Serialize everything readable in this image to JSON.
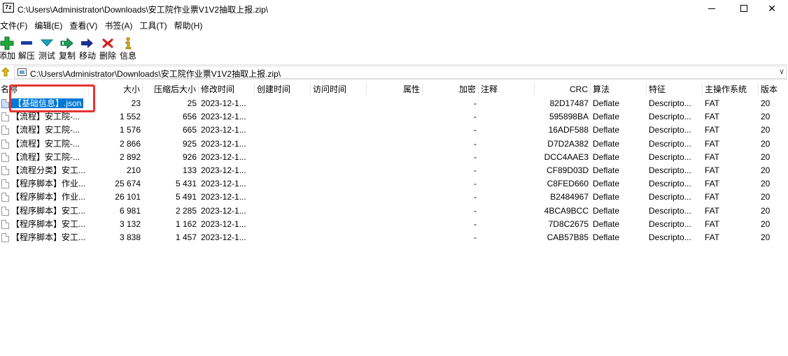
{
  "window": {
    "app_icon": "7z",
    "title": "C:\\Users\\Administrator\\Downloads\\安工院作业票V1V2抽取上报.zip\\",
    "close_glyph": "✕"
  },
  "menu": [
    "文件(F)",
    "编辑(E)",
    "查看(V)",
    "书签(A)",
    "工具(T)",
    "帮助(H)"
  ],
  "toolbar": [
    {
      "label": "添加",
      "icon": "add-icon",
      "color": "#1faa3a"
    },
    {
      "label": "解压",
      "icon": "extract-icon",
      "color": "#1c3f9c"
    },
    {
      "label": "测试",
      "icon": "test-icon",
      "color": "#1fa4c0"
    },
    {
      "label": "复制",
      "icon": "copy-icon",
      "color": "#1e9a5a"
    },
    {
      "label": "移动",
      "icon": "move-icon",
      "color": "#1c2f8c"
    },
    {
      "label": "删除",
      "icon": "delete-icon",
      "color": "#d42020"
    },
    {
      "label": "信息",
      "icon": "info-icon",
      "color": "#d8b400"
    }
  ],
  "address": {
    "path": "C:\\Users\\Administrator\\Downloads\\安工院作业票V1V2抽取上报.zip\\",
    "dropdown_glyph": "∨"
  },
  "columns": [
    "名称",
    "大小",
    "压缩后大小",
    "修改时间",
    "创建时间",
    "访问时间",
    "属性",
    "加密",
    "注释",
    "CRC",
    "算法",
    "特征",
    "主操作系统",
    "版本"
  ],
  "files": [
    {
      "name": "【基础信息】.json",
      "size": "23",
      "packed": "25",
      "modified": "2023-12-1...",
      "encrypted": "-",
      "crc": "82D17487",
      "method": "Deflate",
      "characteristics": "Descripto...",
      "host_os": "FAT",
      "version": "20",
      "selected": true
    },
    {
      "name": "【流程】安工院-...",
      "size": "1 552",
      "packed": "656",
      "modified": "2023-12-1...",
      "encrypted": "-",
      "crc": "595898BA",
      "method": "Deflate",
      "characteristics": "Descripto...",
      "host_os": "FAT",
      "version": "20"
    },
    {
      "name": "【流程】安工院-...",
      "size": "1 576",
      "packed": "665",
      "modified": "2023-12-1...",
      "encrypted": "-",
      "crc": "16ADF588",
      "method": "Deflate",
      "characteristics": "Descripto...",
      "host_os": "FAT",
      "version": "20"
    },
    {
      "name": "【流程】安工院-...",
      "size": "2 866",
      "packed": "925",
      "modified": "2023-12-1...",
      "encrypted": "-",
      "crc": "D7D2A382",
      "method": "Deflate",
      "characteristics": "Descripto...",
      "host_os": "FAT",
      "version": "20"
    },
    {
      "name": "【流程】安工院-...",
      "size": "2 892",
      "packed": "926",
      "modified": "2023-12-1...",
      "encrypted": "-",
      "crc": "DCC4AAE3",
      "method": "Deflate",
      "characteristics": "Descripto...",
      "host_os": "FAT",
      "version": "20"
    },
    {
      "name": "【流程分类】安工...",
      "size": "210",
      "packed": "133",
      "modified": "2023-12-1...",
      "encrypted": "-",
      "crc": "CF89D03D",
      "method": "Deflate",
      "characteristics": "Descripto...",
      "host_os": "FAT",
      "version": "20"
    },
    {
      "name": "【程序脚本】作业...",
      "size": "25 674",
      "packed": "5 431",
      "modified": "2023-12-1...",
      "encrypted": "-",
      "crc": "C8FED660",
      "method": "Deflate",
      "characteristics": "Descripto...",
      "host_os": "FAT",
      "version": "20"
    },
    {
      "name": "【程序脚本】作业...",
      "size": "26 101",
      "packed": "5 491",
      "modified": "2023-12-1...",
      "encrypted": "-",
      "crc": "B2484967",
      "method": "Deflate",
      "characteristics": "Descripto...",
      "host_os": "FAT",
      "version": "20"
    },
    {
      "name": "【程序脚本】安工...",
      "size": "6 981",
      "packed": "2 285",
      "modified": "2023-12-1...",
      "encrypted": "-",
      "crc": "4BCA9BCC",
      "method": "Deflate",
      "characteristics": "Descripto...",
      "host_os": "FAT",
      "version": "20"
    },
    {
      "name": "【程序脚本】安工...",
      "size": "3 132",
      "packed": "1 162",
      "modified": "2023-12-1...",
      "encrypted": "-",
      "crc": "7D8C2675",
      "method": "Deflate",
      "characteristics": "Descripto...",
      "host_os": "FAT",
      "version": "20"
    },
    {
      "name": "【程序脚本】安工...",
      "size": "3 838",
      "packed": "1 457",
      "modified": "2023-12-1...",
      "encrypted": "-",
      "crc": "CAB57B85",
      "method": "Deflate",
      "characteristics": "Descripto...",
      "host_os": "FAT",
      "version": "20"
    }
  ],
  "colors": {
    "selection": "#0078d7",
    "highlight_box": "#e53333"
  }
}
